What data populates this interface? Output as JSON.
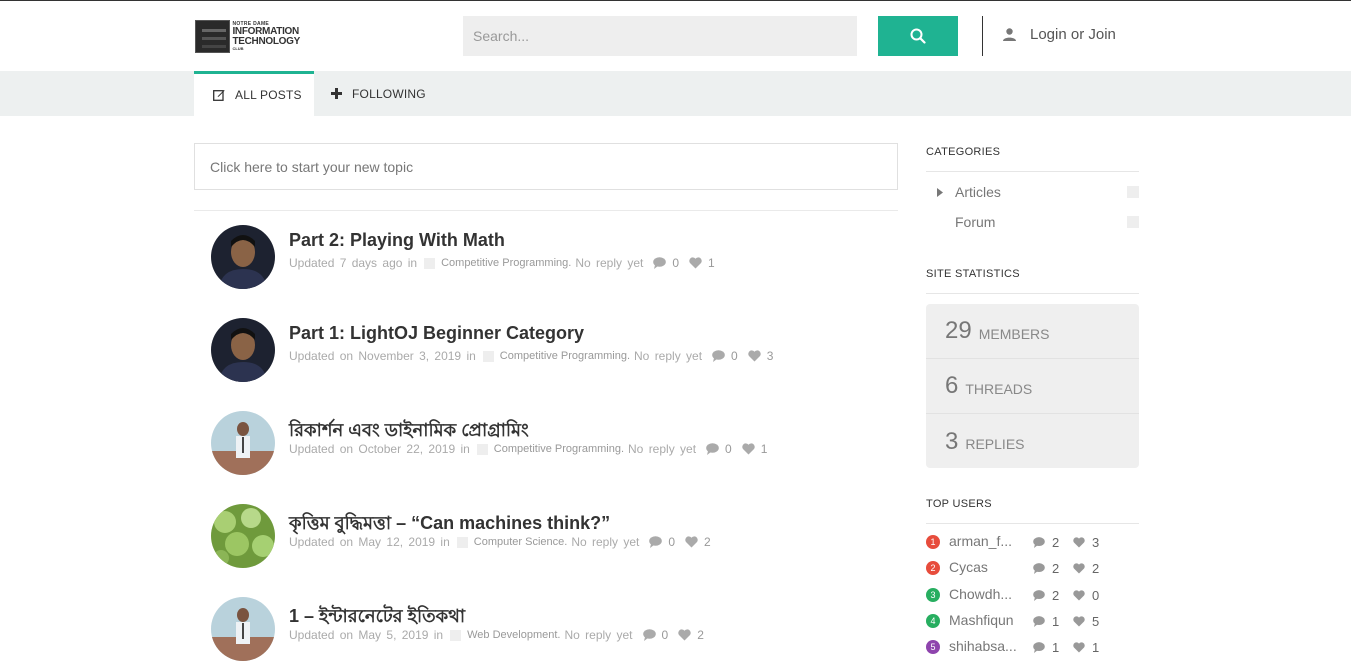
{
  "header": {
    "logo": {
      "line1": "NOTRE DAME",
      "line2": "INFORMATION",
      "line3": "TECHNOLOGY",
      "line4": "CLUB"
    },
    "search_placeholder": "Search...",
    "login_label": "Login or Join"
  },
  "tabs": [
    {
      "label": "ALL POSTS",
      "icon": "edit-icon",
      "active": true
    },
    {
      "label": "FOLLOWING",
      "icon": "plus-icon",
      "active": false
    }
  ],
  "new_topic_placeholder": "Click here to start your new topic",
  "posts": [
    {
      "title": "Part 2: Playing With Math",
      "updated": "Updated 7 days ago in",
      "category": "Competitive Programming.",
      "replies_text": "No reply yet",
      "comments": "0",
      "likes": "1",
      "avatar": "dark-portrait"
    },
    {
      "title": "Part 1: LightOJ Beginner Category",
      "updated": "Updated on November 3, 2019 in",
      "category": "Competitive Programming.",
      "replies_text": "No reply yet",
      "comments": "0",
      "likes": "3",
      "avatar": "dark-portrait"
    },
    {
      "title": "রিকার্শন এবং ডাইনামিক প্রোগ্রামিং",
      "updated": "Updated on October 22, 2019 in",
      "category": "Competitive Programming.",
      "replies_text": "No reply yet",
      "comments": "0",
      "likes": "1",
      "avatar": "speaker-portrait"
    },
    {
      "title": "কৃত্তিম বুদ্ধিমত্তা – “Can machines think?”",
      "updated": "Updated on May 12, 2019 in",
      "category": "Computer Science.",
      "replies_text": "No reply yet",
      "comments": "0",
      "likes": "2",
      "avatar": "green-abstract"
    },
    {
      "title": "1 – ইন্টারনেটের ইতিকথা",
      "updated": "Updated on May 5, 2019 in",
      "category": "Web Development.",
      "replies_text": "No reply yet",
      "comments": "0",
      "likes": "2",
      "avatar": "speaker-portrait"
    }
  ],
  "sidebar": {
    "categories_heading": "CATEGORIES",
    "categories": [
      {
        "label": "Articles",
        "has_children": true
      },
      {
        "label": "Forum",
        "has_children": false
      }
    ],
    "stats_heading": "SITE STATISTICS",
    "stats": [
      {
        "value": "29",
        "label": "MEMBERS"
      },
      {
        "value": "6",
        "label": "THREADS"
      },
      {
        "value": "3",
        "label": "REPLIES"
      }
    ],
    "top_users_heading": "TOP USERS",
    "top_users": [
      {
        "rank": "1",
        "name": "arman_f...",
        "comments": "2",
        "likes": "3",
        "color": "#e74c3c"
      },
      {
        "rank": "2",
        "name": "Cycas",
        "comments": "2",
        "likes": "2",
        "color": "#e74c3c"
      },
      {
        "rank": "3",
        "name": "Chowdh...",
        "comments": "2",
        "likes": "0",
        "color": "#27ae60"
      },
      {
        "rank": "4",
        "name": "Mashfiqun",
        "comments": "1",
        "likes": "5",
        "color": "#27ae60"
      },
      {
        "rank": "5",
        "name": "shihabsa...",
        "comments": "1",
        "likes": "1",
        "color": "#8e44ad"
      }
    ]
  },
  "colors": {
    "accent": "#1fb392",
    "tabbar": "#edf0f0",
    "stats_bg": "#efefef"
  }
}
